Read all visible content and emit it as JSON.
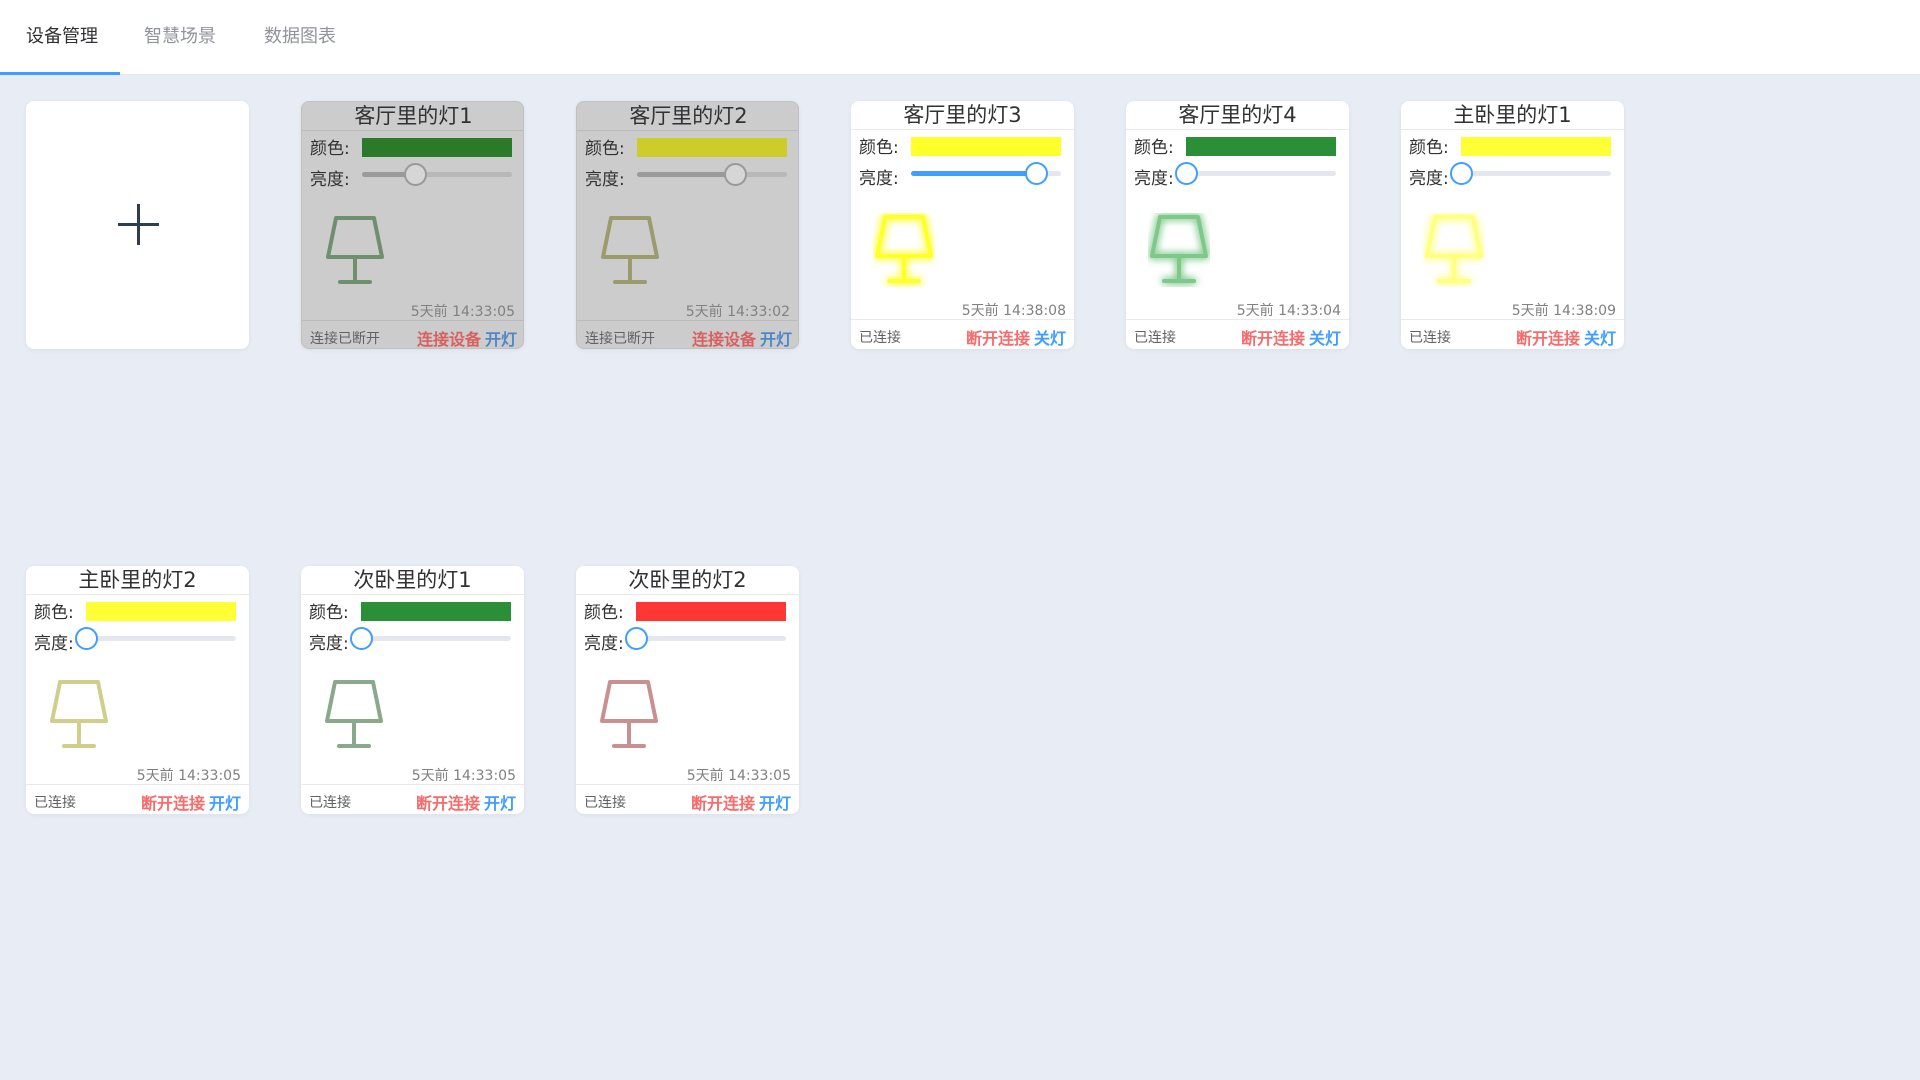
{
  "tabs": [
    {
      "label": "设备管理",
      "active": true
    },
    {
      "label": "智慧场景",
      "active": false
    },
    {
      "label": "数据图表",
      "active": false
    }
  ],
  "add_device": {
    "icon": "plus-icon"
  },
  "labels": {
    "color": "颜色:",
    "brightness": "亮度:"
  },
  "colors": {
    "accent": "#409eff",
    "danger": "#f56c6c",
    "page_bg": "#e8ecf4"
  },
  "devices": [
    {
      "name": "客厅里的灯1",
      "color": "#2a7a2a",
      "brightness": 0.35,
      "lamp_color": "#6f8f6f",
      "lamp_on": false,
      "timestamp": "5天前 14:33:05",
      "status": "连接已断开",
      "connect_action": "连接设备",
      "light_action": "开灯",
      "online": false
    },
    {
      "name": "客厅里的灯2",
      "color": "#cccc2a",
      "brightness": 0.65,
      "lamp_color": "#9b9b6e",
      "lamp_on": false,
      "timestamp": "5天前 14:33:02",
      "status": "连接已断开",
      "connect_action": "连接设备",
      "light_action": "开灯",
      "online": false
    },
    {
      "name": "客厅里的灯3",
      "color": "#ffff2a",
      "brightness": 0.83,
      "lamp_color": "#ffff2a",
      "lamp_on": true,
      "timestamp": "5天前 14:38:08",
      "status": "已连接",
      "connect_action": "断开连接",
      "light_action": "关灯",
      "online": true
    },
    {
      "name": "客厅里的灯4",
      "color": "#2a8f36",
      "brightness": 0.0,
      "lamp_color": "#7ec88a",
      "lamp_on": true,
      "timestamp": "5天前 14:33:04",
      "status": "已连接",
      "connect_action": "断开连接",
      "light_action": "关灯",
      "online": true
    },
    {
      "name": "主卧里的灯1",
      "color": "#ffff36",
      "brightness": 0.0,
      "lamp_color": "#ffff80",
      "lamp_on": true,
      "timestamp": "5天前 14:38:09",
      "status": "已连接",
      "connect_action": "断开连接",
      "light_action": "关灯",
      "online": true
    },
    {
      "name": "主卧里的灯2",
      "color": "#ffff36",
      "brightness": 0.0,
      "lamp_color": "#cfcf8a",
      "lamp_on": false,
      "timestamp": "5天前 14:33:05",
      "status": "已连接",
      "connect_action": "断开连接",
      "light_action": "开灯",
      "online": true
    },
    {
      "name": "次卧里的灯1",
      "color": "#2a8f36",
      "brightness": 0.0,
      "lamp_color": "#8aa88a",
      "lamp_on": false,
      "timestamp": "5天前 14:33:05",
      "status": "已连接",
      "connect_action": "断开连接",
      "light_action": "开灯",
      "online": true
    },
    {
      "name": "次卧里的灯2",
      "color": "#ff3636",
      "brightness": 0.0,
      "lamp_color": "#c89090",
      "lamp_on": false,
      "timestamp": "5天前 14:33:05",
      "status": "已连接",
      "connect_action": "断开连接",
      "light_action": "开灯",
      "online": true
    }
  ]
}
